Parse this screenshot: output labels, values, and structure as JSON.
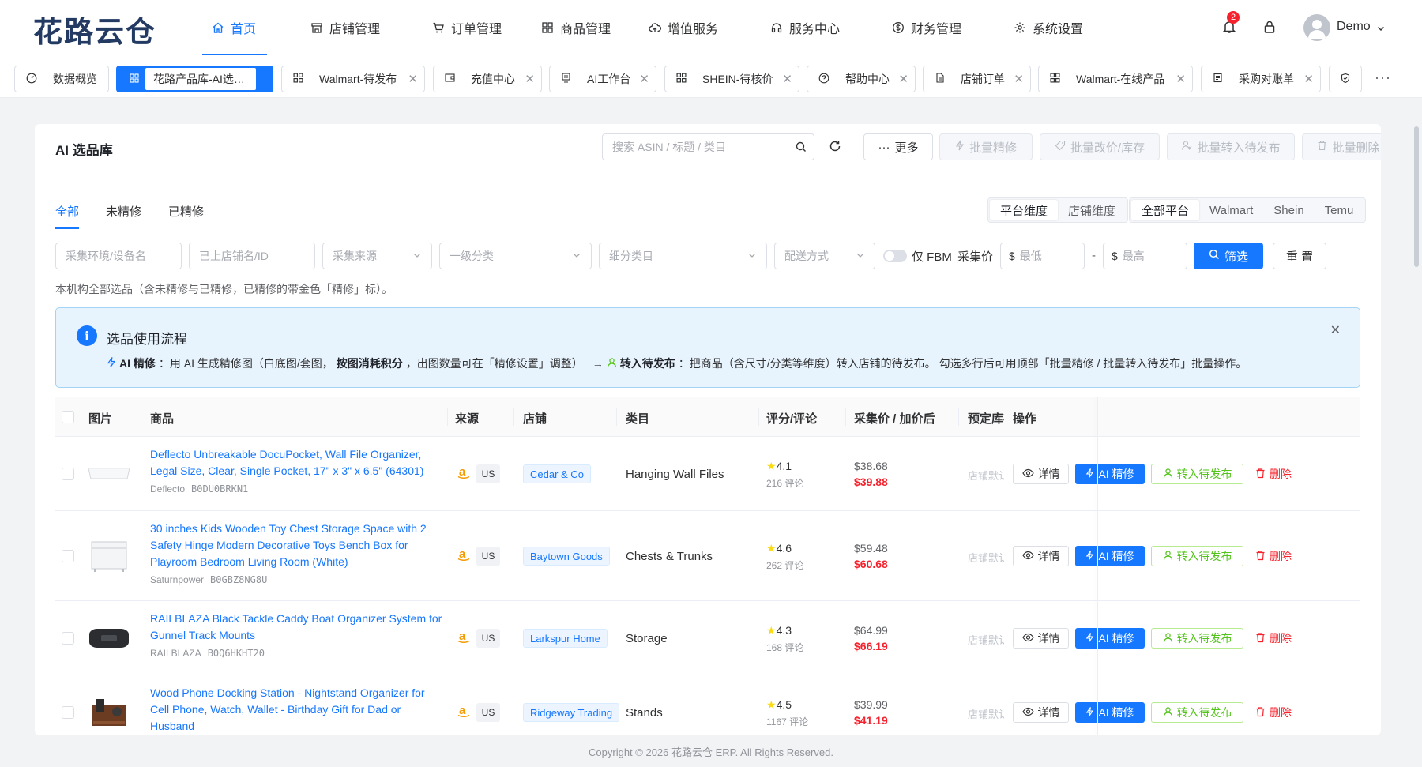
{
  "app": {
    "logo": "花路云仓"
  },
  "nav": {
    "items": [
      {
        "label": "首页",
        "icon": "home-icon"
      },
      {
        "label": "店铺管理",
        "icon": "store-icon"
      },
      {
        "label": "订单管理",
        "icon": "cart-icon"
      },
      {
        "label": "商品管理",
        "icon": "grid-icon"
      },
      {
        "label": "增值服务",
        "icon": "cloud-upload-icon"
      },
      {
        "label": "服务中心",
        "icon": "headset-icon"
      },
      {
        "label": "财务管理",
        "icon": "dollar-icon"
      },
      {
        "label": "系统设置",
        "icon": "gear-icon"
      }
    ],
    "notification_count": "2",
    "user_name": "Demo"
  },
  "tabs": [
    {
      "label": "数据概览"
    },
    {
      "label": "花路产品库-AI选…"
    },
    {
      "label": "Walmart-待发布"
    },
    {
      "label": "充值中心"
    },
    {
      "label": "AI工作台"
    },
    {
      "label": "SHEIN-待核价"
    },
    {
      "label": "帮助中心"
    },
    {
      "label": "店铺订单"
    },
    {
      "label": "Walmart-在线产品"
    },
    {
      "label": "采购对账单"
    }
  ],
  "header": {
    "title": "AI 选品库",
    "search_placeholder": "搜索 ASIN / 标题 / 类目",
    "more": "更多",
    "batch_refine": "批量精修",
    "batch_price": "批量改价/库存",
    "batch_publish": "批量转入待发布",
    "batch_delete": "批量删除"
  },
  "status_tabs": [
    "全部",
    "未精修",
    "已精修"
  ],
  "dimension": {
    "platform": "平台维度",
    "store": "店铺维度"
  },
  "platforms": [
    "全部平台",
    "Walmart",
    "Shein",
    "Temu"
  ],
  "filters": {
    "env": "采集环境/设备名",
    "store": "已上店铺名/ID",
    "source": "采集来源",
    "level1": "一级分类",
    "sub": "细分类目",
    "shipping": "配送方式",
    "fbm": "仅 FBM",
    "price_label": "采集价",
    "min": "最低",
    "max": "最高",
    "currency": "$",
    "dash": "-",
    "filter_btn": "筛选",
    "reset_btn": "重 置"
  },
  "description": "本机构全部选品（含未精修与已精修，已精修的带金色「精修」标）。",
  "info": {
    "title": "选品使用流程",
    "ai_label": "AI 精修",
    "ai_text1": "：用 AI 生成精修图（白底图/套图，",
    "ai_bold": "按图消耗积分",
    "ai_text2": "，出图数量可在「精修设置」调整）",
    "arrow": "→",
    "pub_label": "转入待发布",
    "pub_text": "：把商品（含尺寸/分类等维度）转入店铺的待发布。 勾选多行后可用顶部「批量精修 / 批量转入待发布」批量操作。"
  },
  "table": {
    "columns": [
      "图片",
      "商品",
      "来源",
      "店铺",
      "类目",
      "评分/评论",
      "采集价 / 加价后",
      "预定库存",
      "操作"
    ],
    "actions": {
      "detail": "详情",
      "ai": "AI 精修",
      "publish": "转入待发布",
      "delete": "删除"
    },
    "rows": [
      {
        "title": "Deflecto Unbreakable DocuPocket, Wall File Organizer, Legal Size, Clear, Single Pocket, 17\" x 3\" x 6.5\" (64301)",
        "brand": "Deflecto",
        "asin": "B0DU0BRKN1",
        "site": "US",
        "store": "Cedar & Co",
        "category": "Hanging Wall Files",
        "rating": "4.1",
        "reviews": "216 评论",
        "cost": "$38.68",
        "price": "$39.88",
        "reserve": "店铺默认"
      },
      {
        "title": "30 inches Kids Wooden Toy Chest Storage Space with 2 Safety Hinge Modern Decorative Toys Bench Box for Playroom Bedroom Living Room (White)",
        "brand": "Saturnpower",
        "asin": "B0GBZ8NG8U",
        "site": "US",
        "store": "Baytown Goods",
        "category": "Chests & Trunks",
        "rating": "4.6",
        "reviews": "262 评论",
        "cost": "$59.48",
        "price": "$60.68",
        "reserve": "店铺默认"
      },
      {
        "title": "RAILBLAZA Black Tackle Caddy Boat Organizer System for Gunnel Track Mounts",
        "brand": "RAILBLAZA",
        "asin": "B0Q6HKHT20",
        "site": "US",
        "store": "Larkspur Home",
        "category": "Storage",
        "rating": "4.3",
        "reviews": "168 评论",
        "cost": "$64.99",
        "price": "$66.19",
        "reserve": "店铺默认"
      },
      {
        "title": "Wood Phone Docking Station - Nightstand Organizer for Cell Phone, Watch, Wallet - Birthday Gift for Dad or Husband",
        "brand": "",
        "asin": "",
        "site": "US",
        "store": "Ridgeway Trading",
        "category": "Stands",
        "rating": "4.5",
        "reviews": "1167 评论",
        "cost": "$39.99",
        "price": "$41.19",
        "reserve": "店铺默认"
      }
    ]
  },
  "footer": "Copyright © 2026 花路云仓 ERP. All Rights Reserved."
}
